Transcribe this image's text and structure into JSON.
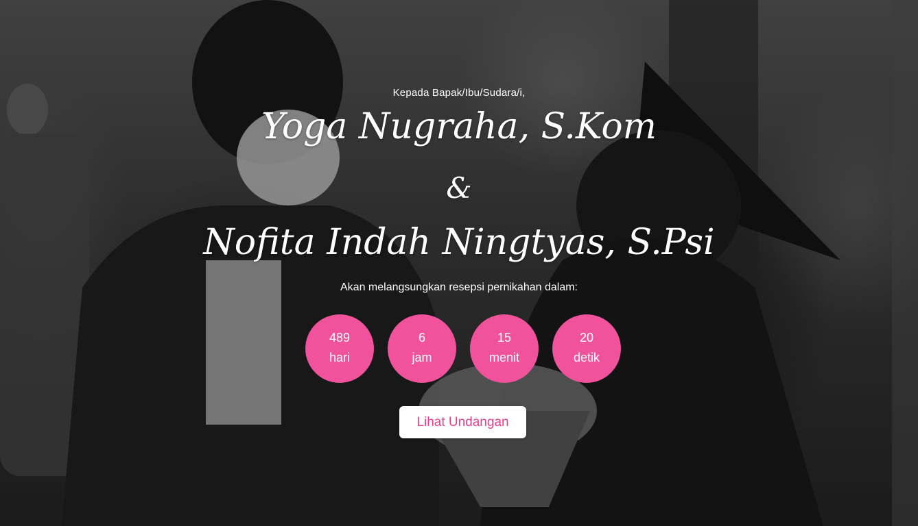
{
  "greeting": "Kepada Bapak/Ibu/Sudara/i,",
  "couple": {
    "groom": "Yoga Nugraha, S.Kom",
    "ampersand": "&",
    "bride": "Nofita Indah Ningtyas, S.Psi"
  },
  "subtitle": "Akan melangsungkan resepsi pernikahan dalam:",
  "countdown": {
    "days": {
      "value": "489",
      "unit": "hari"
    },
    "hours": {
      "value": "6",
      "unit": "jam"
    },
    "minutes": {
      "value": "15",
      "unit": "menit"
    },
    "seconds": {
      "value": "20",
      "unit": "detik"
    }
  },
  "open_button_label": "Lihat Undangan",
  "colors": {
    "accent": "#f0529b",
    "button_text": "#e6408d",
    "text": "#ffffff"
  }
}
